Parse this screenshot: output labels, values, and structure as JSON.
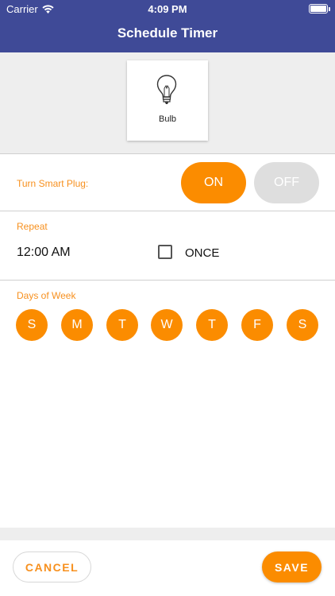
{
  "status_bar": {
    "carrier": "Carrier",
    "time": "4:09 PM",
    "wifi_icon": "wifi-icon",
    "battery_icon": "battery-icon"
  },
  "header": {
    "title": "Schedule Timer"
  },
  "device": {
    "label": "Bulb",
    "icon": "lightbulb-icon"
  },
  "plug": {
    "label": "Turn Smart Plug:",
    "on_label": "ON",
    "off_label": "OFF",
    "selected": "ON"
  },
  "repeat": {
    "label": "Repeat",
    "time": "12:00 AM",
    "once_label": "ONCE",
    "once_checked": false
  },
  "days": {
    "label": "Days of Week",
    "items": [
      "S",
      "M",
      "T",
      "W",
      "T",
      "F",
      "S"
    ]
  },
  "footer": {
    "cancel_label": "CANCEL",
    "save_label": "SAVE"
  },
  "colors": {
    "header": "#3f4a97",
    "accent": "#fb8c00",
    "label": "#f7901e",
    "off": "#dedede",
    "panel": "#eeeeee"
  }
}
